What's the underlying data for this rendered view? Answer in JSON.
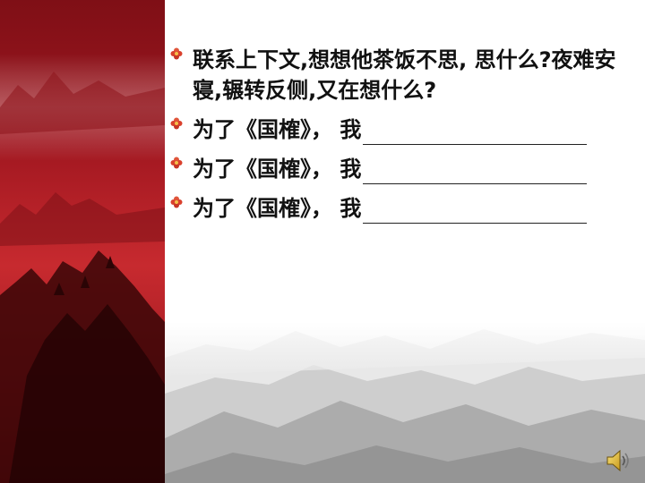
{
  "slide": {
    "bullets": [
      {
        "text": "联系上下文,想想他茶饭不思, 思什么?夜难安寝,辗转反侧,又在想什么?"
      },
      {
        "prefix": "为了《国榷》， 我",
        "blank": ""
      },
      {
        "prefix": "为了《国榷》， 我",
        "blank": ""
      },
      {
        "prefix": "为了《国榷》， 我",
        "blank": ""
      }
    ],
    "icons": {
      "bullet": "flower-bullet-icon",
      "audio": "speaker-icon"
    }
  },
  "colors": {
    "band": "#a11720",
    "band_dark": "#6e0d12",
    "bullet": "#d9402d",
    "text": "#111111"
  }
}
